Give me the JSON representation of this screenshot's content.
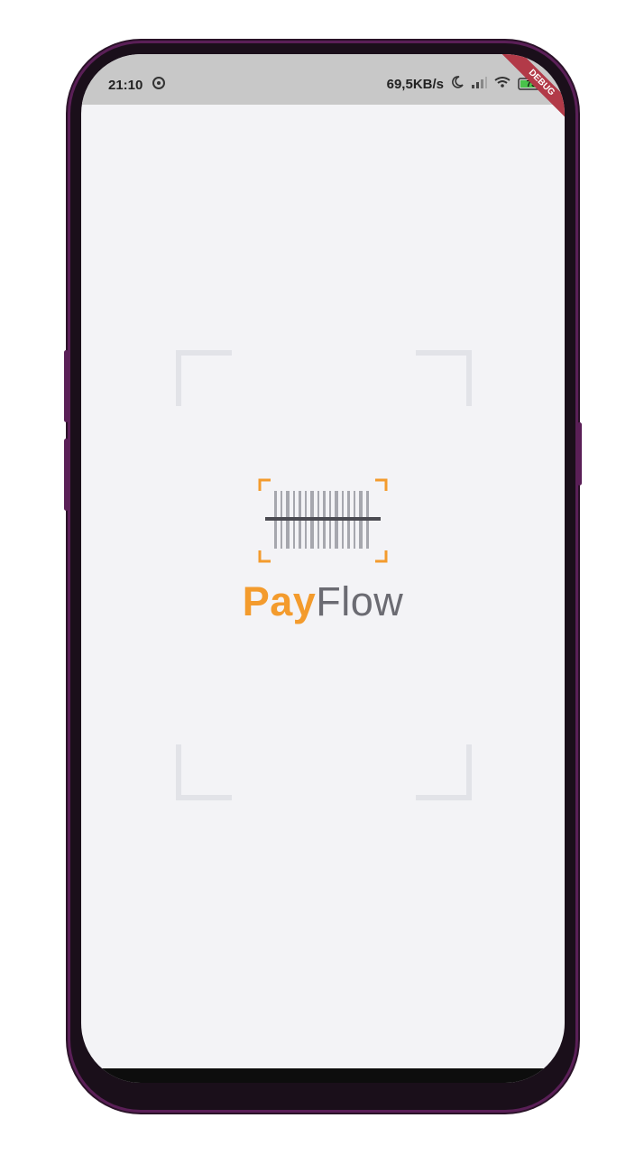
{
  "status_bar": {
    "time": "21:10",
    "speed": "69,5KB/s",
    "battery": "75"
  },
  "debug_banner": "DEBUG",
  "brand": {
    "part1": "Pay",
    "part2": "Flow"
  },
  "colors": {
    "accent": "#f39b2d",
    "text_gray": "#6b6b72",
    "background": "#f3f3f6"
  }
}
